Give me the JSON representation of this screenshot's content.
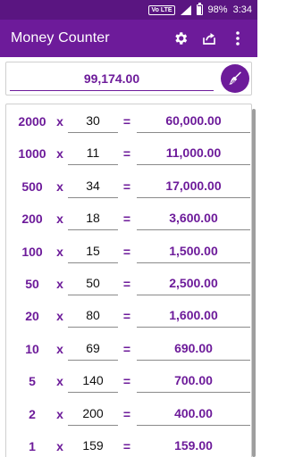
{
  "status_bar": {
    "network_badge": "Vo LTE",
    "battery": "98%",
    "time": "3:34"
  },
  "app_bar": {
    "title": "Money Counter",
    "icons": [
      "gear-icon",
      "share-icon",
      "more-vert-icon"
    ]
  },
  "total": {
    "value": "99,174.00",
    "clear_icon": "broom-icon"
  },
  "colors": {
    "status_bar": "#5a1581",
    "primary": "#6d1b9a",
    "text_dark": "#111111"
  },
  "symbols": {
    "times": "x",
    "equals": "="
  },
  "rows": [
    {
      "denomination": "2000",
      "quantity": "30",
      "amount": "60,000.00"
    },
    {
      "denomination": "1000",
      "quantity": "11",
      "amount": "11,000.00"
    },
    {
      "denomination": "500",
      "quantity": "34",
      "amount": "17,000.00"
    },
    {
      "denomination": "200",
      "quantity": "18",
      "amount": "3,600.00"
    },
    {
      "denomination": "100",
      "quantity": "15",
      "amount": "1,500.00"
    },
    {
      "denomination": "50",
      "quantity": "50",
      "amount": "2,500.00"
    },
    {
      "denomination": "20",
      "quantity": "80",
      "amount": "1,600.00"
    },
    {
      "denomination": "10",
      "quantity": "69",
      "amount": "690.00"
    },
    {
      "denomination": "5",
      "quantity": "140",
      "amount": "700.00"
    },
    {
      "denomination": "2",
      "quantity": "200",
      "amount": "400.00"
    },
    {
      "denomination": "1",
      "quantity": "159",
      "amount": "159.00"
    }
  ]
}
